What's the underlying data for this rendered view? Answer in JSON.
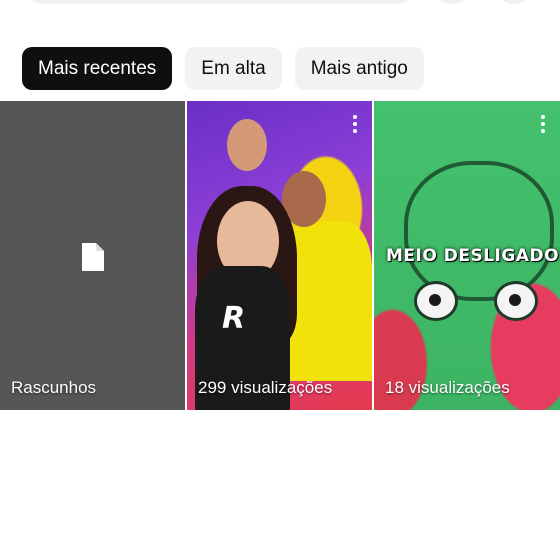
{
  "filters": {
    "chips": [
      {
        "label": "Mais recentes",
        "selected": true
      },
      {
        "label": "Em alta",
        "selected": false
      },
      {
        "label": "Mais antigo",
        "selected": false
      }
    ]
  },
  "grid": {
    "drafts": {
      "label": "Rascunhos",
      "icon": "document-icon"
    },
    "videos": [
      {
        "views_label": "299 visualizações",
        "overlay_text": ""
      },
      {
        "views_label": "18 visualizações",
        "overlay_text": "MEIO DESLIGADO!"
      }
    ]
  },
  "colors": {
    "chip_active_bg": "#0f0f0f",
    "chip_bg": "#f2f2f2",
    "draft_tile_bg": "#555555"
  }
}
